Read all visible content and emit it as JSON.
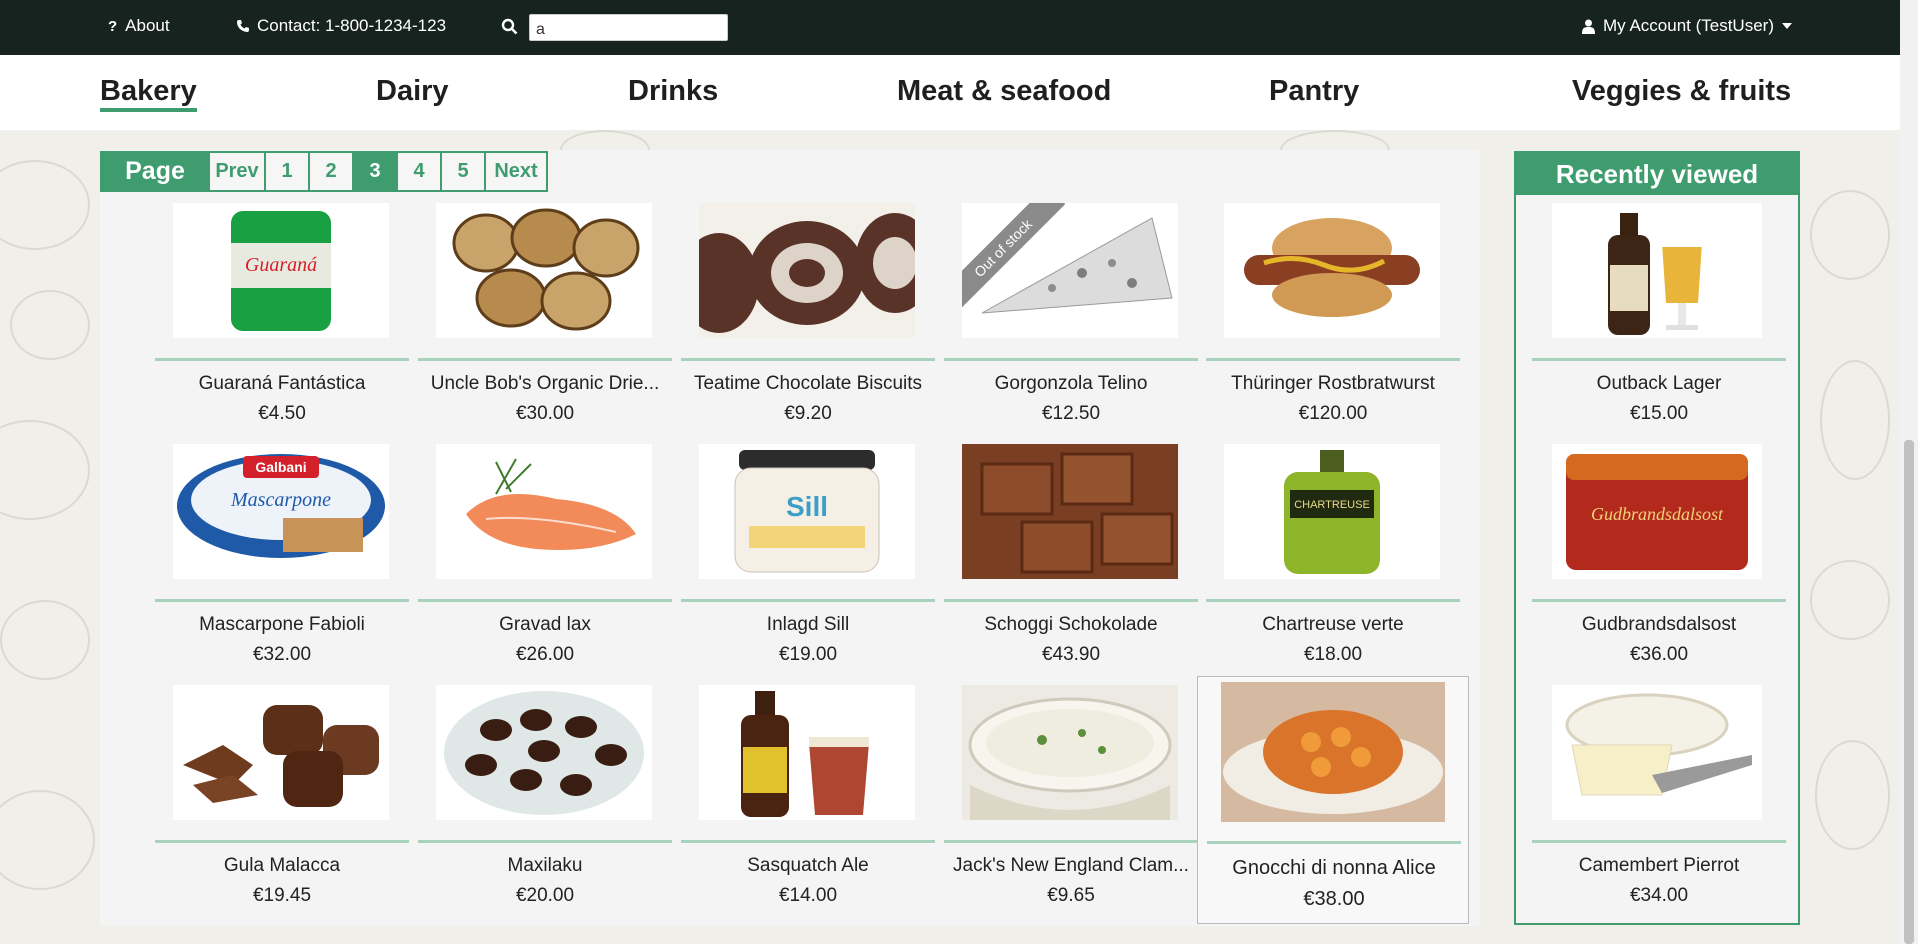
{
  "topbar": {
    "about": "About",
    "contact": "Contact: 1-800-1234-123",
    "search_value": "a",
    "account": "My Account (TestUser)"
  },
  "categories": [
    "Bakery",
    "Dairy",
    "Drinks",
    "Meat & seafood",
    "Pantry",
    "Veggies & fruits"
  ],
  "active_category": "Bakery",
  "pager": {
    "label": "Page",
    "prev": "Prev",
    "pages": [
      "1",
      "2",
      "3",
      "4",
      "5"
    ],
    "current": "3",
    "next": "Next"
  },
  "products": [
    {
      "name": "Guaraná Fantástica",
      "price": "€4.50"
    },
    {
      "name": "Uncle Bob's Organic Drie...",
      "price": "€30.00"
    },
    {
      "name": "Teatime Chocolate Biscuits",
      "price": "€9.20"
    },
    {
      "name": "Gorgonzola Telino",
      "price": "€12.50",
      "badge": "Out of stock"
    },
    {
      "name": "Thüringer Rostbratwurst",
      "price": "€120.00"
    },
    {
      "name": "Mascarpone Fabioli",
      "price": "€32.00"
    },
    {
      "name": "Gravad lax",
      "price": "€26.00"
    },
    {
      "name": "Inlagd Sill",
      "price": "€19.00"
    },
    {
      "name": "Schoggi Schokolade",
      "price": "€43.90"
    },
    {
      "name": "Chartreuse verte",
      "price": "€18.00"
    },
    {
      "name": "Gula Malacca",
      "price": "€19.45"
    },
    {
      "name": "Maxilaku",
      "price": "€20.00"
    },
    {
      "name": "Sasquatch Ale",
      "price": "€14.00"
    },
    {
      "name": "Jack's New England Clam...",
      "price": "€9.65"
    },
    {
      "name": "Gnocchi di nonna Alice",
      "price": "€38.00"
    }
  ],
  "recent": {
    "title": "Recently viewed",
    "items": [
      {
        "name": "Outback Lager",
        "price": "€15.00"
      },
      {
        "name": "Gudbrandsdalsost",
        "price": "€36.00"
      },
      {
        "name": "Camembert Pierrot",
        "price": "€34.00"
      }
    ]
  },
  "colors": {
    "accent": "#3f9c6e",
    "topbar": "#17231e",
    "rule": "#a9d2bc"
  }
}
